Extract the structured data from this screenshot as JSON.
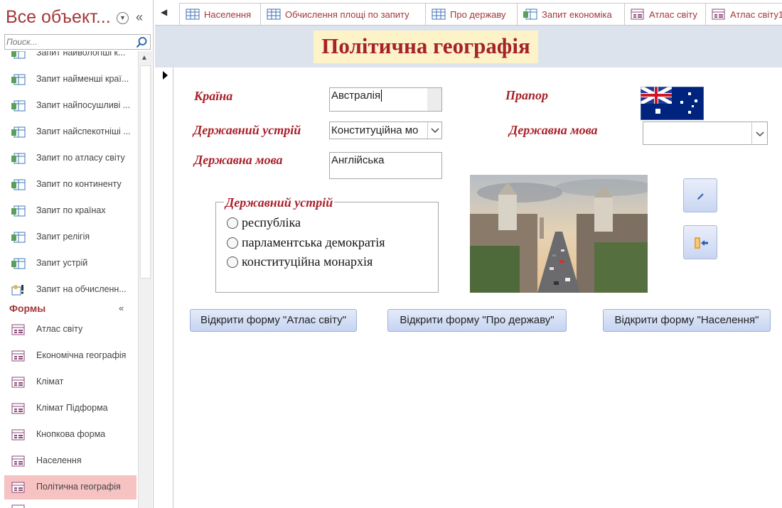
{
  "nav": {
    "title": "Все объект...",
    "search_placeholder": "Поиск...",
    "query_items": [
      "Запит найвологіші к...",
      "Запит найменші краї...",
      "Запит найпосушливі ...",
      "Запит найспекотніші ...",
      "Запит по атласу світу",
      "Запит по континенту",
      "Запит по країнах",
      "Запит релігія",
      "Запит устрій",
      "Запит на обчисленн..."
    ],
    "forms_section": "Формы",
    "form_items": [
      "Атлас світу",
      "Економічна географія",
      "Клімат",
      "Клімат Підформа",
      "Кнопкова форма",
      "Населення",
      "Політична географія"
    ],
    "selected_item": "Політична географія"
  },
  "tabs": [
    {
      "label": "Населення",
      "icon": "table-icon"
    },
    {
      "label": "Обчислення площі по запиту",
      "icon": "table-icon"
    },
    {
      "label": "Про державу",
      "icon": "table-icon"
    },
    {
      "label": "Запит економіка",
      "icon": "query-icon"
    },
    {
      "label": "Атлас світу",
      "icon": "form-icon"
    },
    {
      "label": "Атлас світу1",
      "icon": "form-icon"
    }
  ],
  "form": {
    "title": "Політична географія",
    "country_label": "Країна",
    "country_value": "Австралія",
    "gov_label": "Державний устрій",
    "gov_value": "Конституційна мо",
    "lang_label": "Державна мова",
    "lang_value": "Англійська",
    "flag_label": "Прапор",
    "lang_combo_label": "Державна мова",
    "lang_combo_value": "",
    "frame_label": "Державний устрій",
    "radio_options": [
      "республіка",
      "парламентська демократія",
      "конституційна монархія"
    ],
    "buttons": {
      "open_atlas": "Відкрити форму \"Атлас світу\"",
      "open_state": "Відкрити форму \"Про державу\"",
      "open_population": "Відкрити форму \"Населення\""
    }
  },
  "colors": {
    "accent": "#a4373a",
    "label": "#a8212a",
    "header_bg": "#dce3ec",
    "title_bg": "#fdf2c8",
    "selected": "#f6c2c2"
  }
}
